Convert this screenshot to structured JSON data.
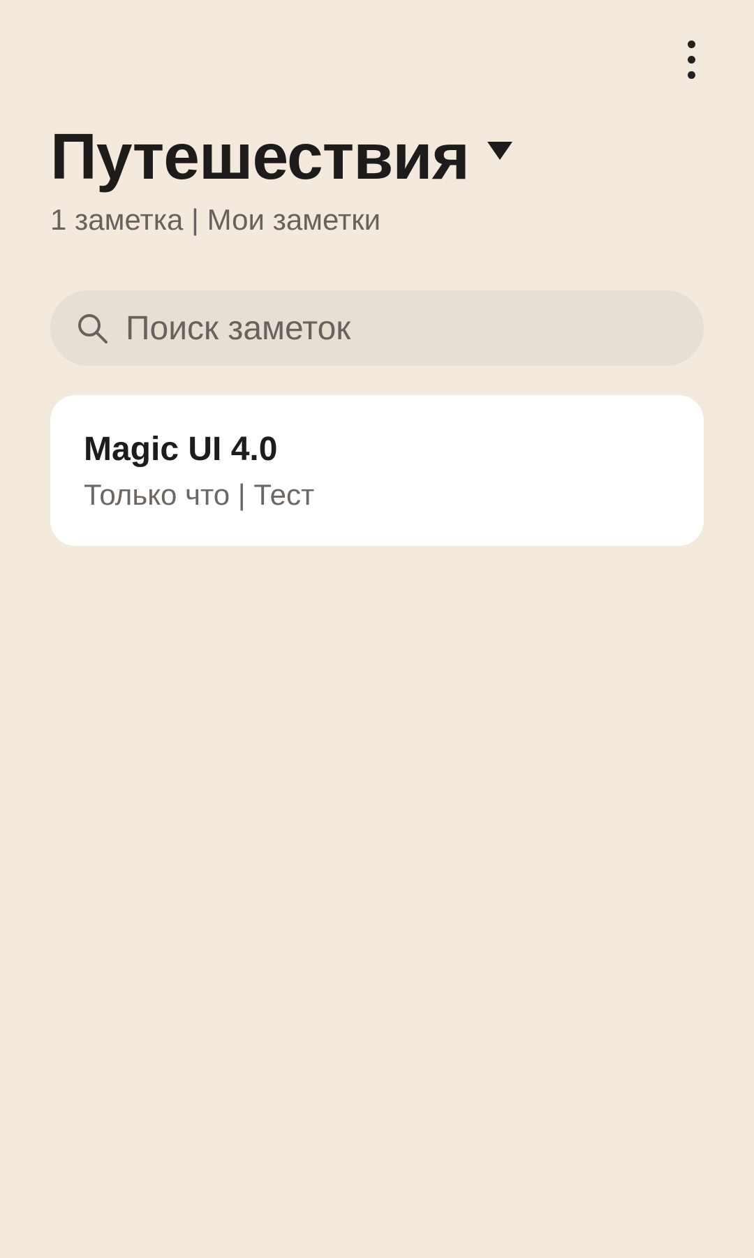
{
  "header": {
    "menu_icon": "more-vertical-icon",
    "folder_title": "Путешествия",
    "dropdown_icon": "triangle-down-icon",
    "subtitle": "1 заметка | Мои заметки"
  },
  "search": {
    "icon": "search-icon",
    "placeholder": "Поиск заметок"
  },
  "notes": [
    {
      "title": "Magic UI 4.0",
      "meta": "Только что | Тест"
    }
  ],
  "colors": {
    "background": "#f3eadd",
    "search_background": "#e6dfd3",
    "card_background": "#ffffff",
    "primary_text": "#1e1c1a",
    "secondary_text": "#67625d"
  }
}
